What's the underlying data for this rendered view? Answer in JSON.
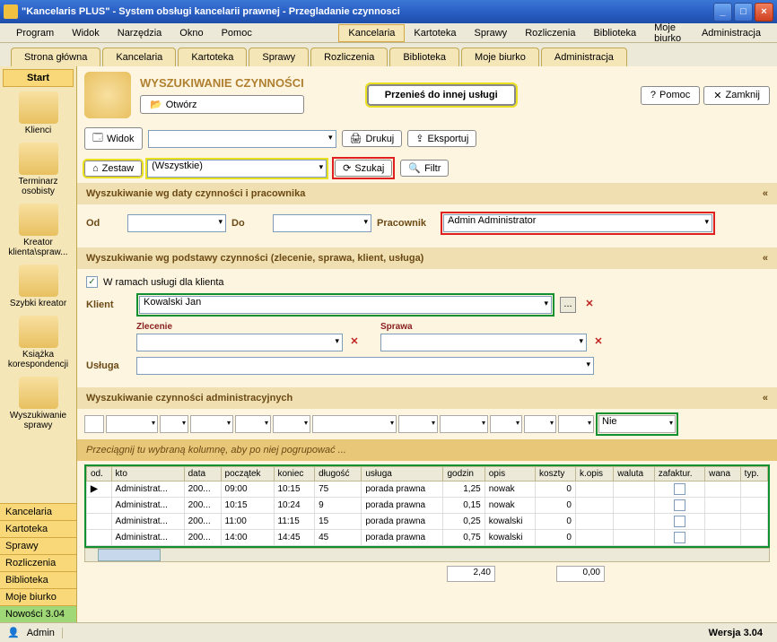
{
  "window": {
    "title": "\"Kancelaris PLUS\" - System obsługi kancelarii prawnej - Przegladanie czynnosci"
  },
  "menubar": [
    "Program",
    "Widok",
    "Narzędzia",
    "Okno",
    "Pomoc",
    "Kancelaria",
    "Kartoteka",
    "Sprawy",
    "Rozliczenia",
    "Biblioteka",
    "Moje biurko",
    "Administracja"
  ],
  "menubar_active_index": 5,
  "tabs": [
    "Strona główna",
    "Kancelaria",
    "Kartoteka",
    "Sprawy",
    "Rozliczenia",
    "Biblioteka",
    "Moje biurko",
    "Administracja"
  ],
  "sidebar": {
    "start": "Start",
    "items": [
      {
        "label": "Klienci"
      },
      {
        "label": "Terminarz osobisty"
      },
      {
        "label": "Kreator klienta\\spraw..."
      },
      {
        "label": "Szybki kreator"
      },
      {
        "label": "Książka korespondencji"
      },
      {
        "label": "Wyszukiwanie sprawy"
      }
    ],
    "bottom": [
      "Kancelaria",
      "Kartoteka",
      "Sprawy",
      "Rozliczenia",
      "Biblioteka",
      "Moje biurko"
    ],
    "news": "Nowości 3.04"
  },
  "page": {
    "title": "WYSZUKIWANIE CZYNNOŚCI",
    "transfer_button": "Przenieś do innej usługi",
    "help": "Pomoc",
    "close": "Zamknij",
    "open": "Otwórz",
    "view_label": "Widok",
    "print": "Drukuj",
    "export": "Eksportuj",
    "set_label": "Zestaw",
    "set_value": "(Wszystkie)",
    "search": "Szukaj",
    "filter": "Filtr"
  },
  "section1": {
    "header": "Wyszukiwanie wg daty czynności i pracownika",
    "od": "Od",
    "do": "Do",
    "pracownik": "Pracownik",
    "pracownik_value": "Admin Administrator"
  },
  "section2": {
    "header": "Wyszukiwanie wg podstawy czynności (zlecenie, sprawa, klient, usługa)",
    "checkbox_label": "W ramach usługi dla klienta",
    "checkbox_checked": true,
    "klient": "Klient",
    "klient_value": "Kowalski Jan",
    "zlecenie": "Zlecenie",
    "sprawa": "Sprawa",
    "usluga": "Usługa"
  },
  "section3": {
    "header": "Wyszukiwanie czynności administracyjnych"
  },
  "filter_nie": "Nie",
  "group_hint": "Przeciągnij tu wybraną kolumnę, aby po niej pogrupować ...",
  "grid": {
    "columns": [
      "od.",
      "kto",
      "data",
      "początek",
      "koniec",
      "długość",
      "usługa",
      "godzin",
      "opis",
      "koszty",
      "k.opis",
      "waluta",
      "zafaktur.",
      "wana",
      "typ."
    ],
    "rows": [
      {
        "kto": "Administrat...",
        "data": "200...",
        "poczatek": "09:00",
        "koniec": "10:15",
        "dlugosc": "75",
        "usluga": "porada prawna",
        "godzin": "1,25",
        "opis": "nowak",
        "koszty": "0",
        "kopis": "",
        "waluta": "",
        "zafaktur": false,
        "wana": ""
      },
      {
        "kto": "Administrat...",
        "data": "200...",
        "poczatek": "10:15",
        "koniec": "10:24",
        "dlugosc": "9",
        "usluga": "porada prawna",
        "godzin": "0,15",
        "opis": "nowak",
        "koszty": "0",
        "kopis": "",
        "waluta": "",
        "zafaktur": false,
        "wana": ""
      },
      {
        "kto": "Administrat...",
        "data": "200...",
        "poczatek": "11:00",
        "koniec": "11:15",
        "dlugosc": "15",
        "usluga": "porada prawna",
        "godzin": "0,25",
        "opis": "kowalski",
        "koszty": "0",
        "kopis": "",
        "waluta": "",
        "zafaktur": false,
        "wana": ""
      },
      {
        "kto": "Administrat...",
        "data": "200...",
        "poczatek": "14:00",
        "koniec": "14:45",
        "dlugosc": "45",
        "usluga": "porada prawna",
        "godzin": "0,75",
        "opis": "kowalski",
        "koszty": "0",
        "kopis": "",
        "waluta": "",
        "zafaktur": false,
        "wana": ""
      }
    ],
    "totals": {
      "godzin": "2,40",
      "koszty": "0,00"
    }
  },
  "statusbar": {
    "user": "Admin",
    "version": "Wersja 3.04"
  }
}
